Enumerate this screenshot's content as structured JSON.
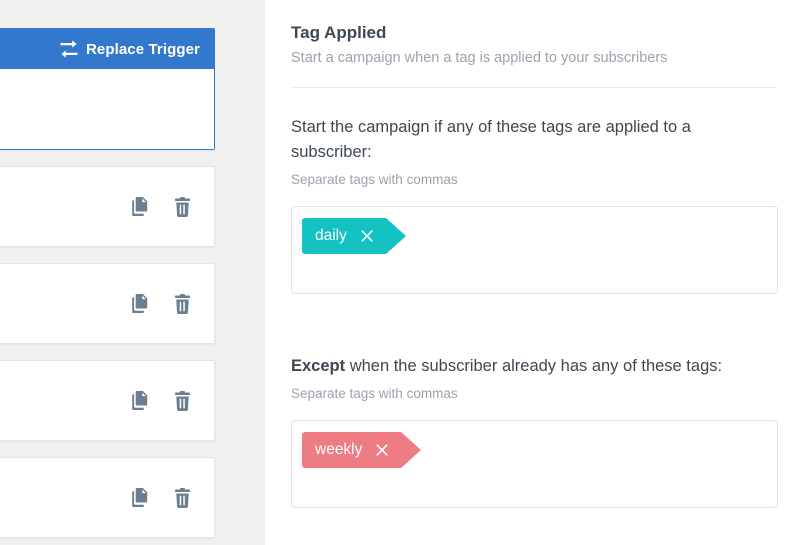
{
  "colors": {
    "trigger_blue": "#3279ce",
    "tag_include_teal": "#15c2c2",
    "tag_exclude_red": "#ee7c85",
    "canvas_gray": "#f0f0f0",
    "icon_slate": "#6b7f91"
  },
  "canvas": {
    "trigger_node": {
      "replace_label": "Replace Trigger",
      "swap_icon": "swap-arrows-icon"
    },
    "action_nodes": [
      {
        "copy_icon": "copy-icon",
        "delete_icon": "trash-icon"
      },
      {
        "copy_icon": "copy-icon",
        "delete_icon": "trash-icon"
      },
      {
        "copy_icon": "copy-icon",
        "delete_icon": "trash-icon"
      },
      {
        "copy_icon": "copy-icon",
        "delete_icon": "trash-icon"
      }
    ]
  },
  "panel": {
    "title": "Tag Applied",
    "subtitle": "Start a campaign when a tag is applied to your subscribers",
    "include": {
      "label_prefix": "",
      "label": "Start the campaign if any of these tags are applied to a subscriber:",
      "hint": "Separate tags with commas",
      "tags": [
        {
          "name": "daily",
          "remove_icon": "close-icon"
        }
      ]
    },
    "exclude": {
      "label_bold": "Except",
      "label_rest": " when the subscriber already has any of these tags:",
      "hint": "Separate tags with commas",
      "tags": [
        {
          "name": "weekly",
          "remove_icon": "close-icon"
        }
      ]
    }
  }
}
